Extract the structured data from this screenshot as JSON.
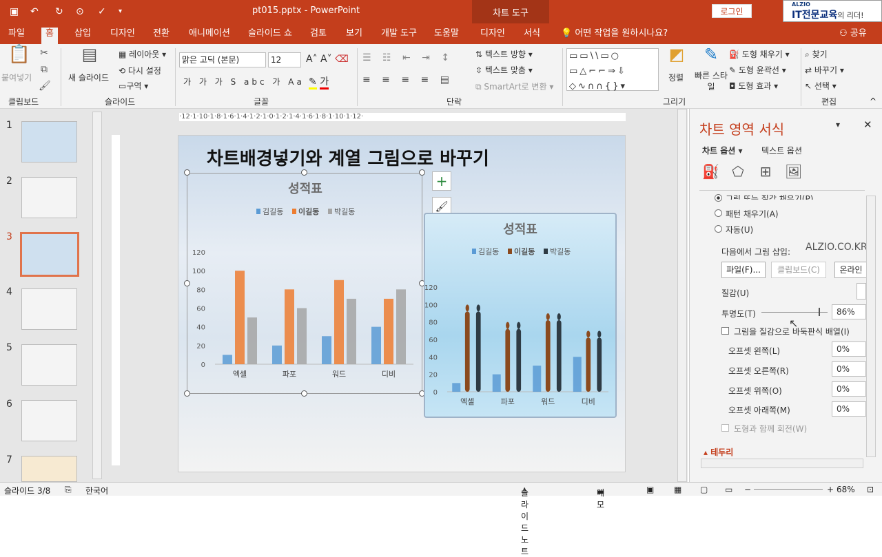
{
  "titlebar": {
    "doc_title": "pt015.pptx  -  PowerPoint",
    "context_tool": "차트 도구",
    "login": "로그인",
    "logo_top": "ALZIO",
    "logo_main": "IT전문교육",
    "logo_suffix": "의 리더!"
  },
  "tabs": [
    "파일",
    "홈",
    "삽입",
    "디자인",
    "전환",
    "애니메이션",
    "슬라이드 쇼",
    "검토",
    "보기",
    "개발 도구",
    "도움말",
    "디자인",
    "서식"
  ],
  "tell_me": "어떤 작업을 원하시나요?",
  "share": "공유",
  "ribbon": {
    "paste": "붙여넣기",
    "new_slide": "새 슬라이드",
    "layout": "레이아웃",
    "reset": "다시 설정",
    "section": "구역",
    "font_name": "맑은 고딕 (본문)",
    "font_size": "12",
    "text_direction": "텍스트 방향",
    "text_align": "텍스트 맞춤",
    "smartart": "SmartArt로 변환",
    "arrange": "정렬",
    "quick_style": "빠른 스타일",
    "shape_fill": "도형 채우기",
    "shape_outline": "도형 윤곽선",
    "shape_effects": "도형 효과",
    "find": "찾기",
    "replace": "바꾸기",
    "select": "선택",
    "groups": [
      "클립보드",
      "슬라이드",
      "글꼴",
      "단락",
      "그리기",
      "편집"
    ]
  },
  "ruler_h": "·12·1·10·1·8·1·6·1·4·1·2·1·0·1·2·1·4·1·6·1·8·1·10·1·12·",
  "thumbnails": [
    "1",
    "2",
    "3",
    "4",
    "5",
    "6",
    "7"
  ],
  "slide": {
    "title": "차트배경넣기와 계열 그림으로 바꾸기"
  },
  "chart_data": [
    {
      "type": "bar",
      "title": "성적표",
      "categories": [
        "엑셀",
        "파포",
        "워드",
        "디비"
      ],
      "series": [
        {
          "name": "김길동",
          "values": [
            10,
            20,
            30,
            40
          ]
        },
        {
          "name": "이길동",
          "values": [
            100,
            80,
            90,
            70
          ]
        },
        {
          "name": "박길동",
          "values": [
            50,
            60,
            70,
            80
          ]
        }
      ],
      "ylim": [
        0,
        120
      ],
      "yticks": [
        "0",
        "20",
        "40",
        "60",
        "80",
        "100",
        "120"
      ],
      "legend": "top",
      "colors": [
        "#5b9bd5",
        "#ed7d31",
        "#a5a5a5"
      ]
    },
    {
      "type": "bar",
      "title": "성적표",
      "categories": [
        "엑셀",
        "파포",
        "워드",
        "디비"
      ],
      "series": [
        {
          "name": "김길동",
          "values": [
            10,
            20,
            30,
            40
          ]
        },
        {
          "name": "이길동",
          "values": [
            100,
            80,
            90,
            70
          ]
        },
        {
          "name": "박길동",
          "values": [
            100,
            80,
            90,
            70
          ]
        }
      ],
      "ylim": [
        0,
        120
      ],
      "yticks": [
        "0",
        "20",
        "40",
        "60",
        "80",
        "100",
        "120"
      ],
      "legend": "top",
      "colors": [
        "#5b9bd5",
        "#8b4a1e",
        "#2e3b44"
      ]
    }
  ],
  "panel": {
    "title": "차트 영역 서식",
    "tab_chart": "차트 옵션",
    "tab_text": "텍스트 옵션",
    "radio_picture": "그림 또는 질감 채우기(P)",
    "radio_pattern": "패턴 채우기(A)",
    "radio_auto": "자동(U)",
    "insert_from": "다음에서 그림 삽입:",
    "watermark": "ALZIO.CO.KR",
    "btn_file": "파일(F)...",
    "btn_clipboard": "클립보드(C)",
    "btn_online": "온라인",
    "texture": "질감(U)",
    "transparency": "투명도(T)",
    "transparency_value": "86%",
    "transparency_fraction": 0.86,
    "tile": "그림을 질감으로 바둑판식 배열(I)",
    "offset_left": "오프셋 왼쪽(L)",
    "offset_right": "오프셋 오른쪽(R)",
    "offset_top": "오프셋 위쪽(O)",
    "offset_bottom": "오프셋 아래쪽(M)",
    "offset_value": "0%",
    "rotate": "도형과 함께 회전(W)",
    "border": "테두리"
  },
  "status": {
    "slide": "슬라이드 3/8",
    "lang": "한국어",
    "notes": "슬라이드 노트",
    "comments": "메모",
    "zoom": "68%"
  }
}
